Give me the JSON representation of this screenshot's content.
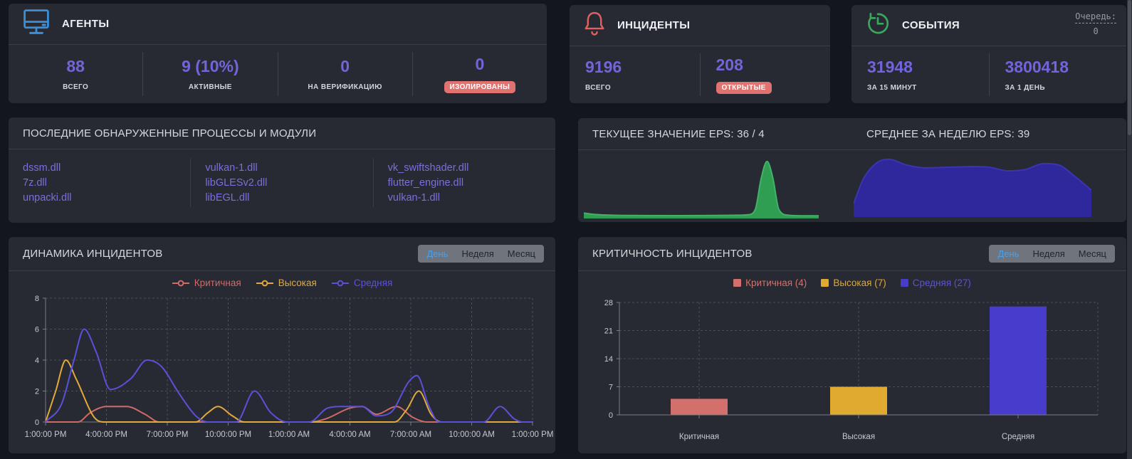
{
  "cards": {
    "agents": {
      "title": "АГЕНТЫ",
      "stats": [
        {
          "value": "88",
          "label": "ВСЕГО"
        },
        {
          "value": "9 (10%)",
          "label": "АКТИВНЫЕ"
        },
        {
          "value": "0",
          "label": "НА ВЕРИФИКАЦИЮ"
        },
        {
          "value": "0",
          "label": "ИЗОЛИРОВАНЫ"
        }
      ]
    },
    "incidents": {
      "title": "ИНЦИДЕНТЫ",
      "stats": [
        {
          "value": "9196",
          "label": "ВСЕГО"
        },
        {
          "value": "208",
          "label": "ОТКРЫТЫЕ"
        }
      ]
    },
    "events": {
      "title": "СОБЫТИЯ",
      "queue": {
        "label": "Очередь:",
        "value": "0"
      },
      "stats": [
        {
          "value": "31948",
          "label": "ЗА 15 МИНУТ"
        },
        {
          "value": "3800418",
          "label": "ЗА 1 ДЕНЬ"
        }
      ]
    },
    "processes": {
      "title": "ПОСЛЕДНИЕ ОБНАРУЖЕННЫЕ ПРОЦЕССЫ И МОДУЛИ",
      "columns": [
        [
          "dssm.dll",
          "7z.dll",
          "unpacki.dll"
        ],
        [
          "vulkan-1.dll",
          "libGLESv2.dll",
          "libEGL.dll"
        ],
        [
          "vk_swiftshader.dll",
          "flutter_engine.dll",
          "vulkan-1.dll"
        ]
      ]
    },
    "dynamics": {
      "title": "ДИНАМИКА ИНЦИДЕНТОВ",
      "tabs": [
        {
          "label": "День",
          "active": true
        },
        {
          "label": "Неделя",
          "active": false
        },
        {
          "label": "Месяц",
          "active": false
        }
      ]
    },
    "criticality": {
      "title": "КРИТИЧНОСТЬ ИНЦИДЕНТОВ",
      "tabs": [
        {
          "label": "День",
          "active": true
        },
        {
          "label": "Неделя",
          "active": false
        },
        {
          "label": "Месяц",
          "active": false
        }
      ]
    }
  },
  "colors": {
    "accent_number": "#7165da",
    "badge_bg": "#e0736f",
    "tab_active": "#4aa0ea",
    "link": "#7a6fdb",
    "agents_icon": "#3a8fd9",
    "incidents_icon": "#e0615f",
    "events_icon": "#3aa85c"
  },
  "chart_data": [
    {
      "id": "eps_current",
      "type": "area",
      "title": "ТЕКУЩЕЕ ЗНАЧЕНИЕ EPS: 36 / 4",
      "color": "#2f9e53",
      "stroke": "#43b269",
      "ymax": 40,
      "x": [
        0,
        0.04,
        0.12,
        0.25,
        0.4,
        0.5,
        0.6,
        0.66,
        0.7,
        0.73,
        0.755,
        0.78,
        0.805,
        0.83,
        0.87,
        0.93,
        1
      ],
      "values": [
        2.6,
        1.8,
        1.2,
        1.0,
        0.9,
        1.0,
        1.1,
        1.2,
        1.5,
        5,
        25,
        36,
        25,
        5,
        1.2,
        0.8,
        0.8
      ]
    },
    {
      "id": "eps_week",
      "type": "area",
      "title": "СРЕДНЕЕ ЗА НЕДЕЛЮ EPS: 39",
      "color": "#2e289c",
      "stroke": "#3c34b0",
      "ymax": 100,
      "x": [
        0,
        0.04,
        0.1,
        0.15,
        0.22,
        0.3,
        0.4,
        0.5,
        0.57,
        0.65,
        0.72,
        0.8,
        0.86,
        0.93,
        1
      ],
      "values": [
        20,
        60,
        88,
        93,
        84,
        79,
        80,
        81,
        80,
        74,
        76,
        86,
        84,
        65,
        42
      ]
    },
    {
      "id": "incident_dynamics",
      "type": "line",
      "title": "ДИНАМИКА ИНЦИДЕНТОВ",
      "x_labels": [
        "1:00:00 PM",
        "4:00:00 PM",
        "7:00:00 PM",
        "10:00:00 PM",
        "1:00:00 AM",
        "4:00:00 AM",
        "7:00:00 AM",
        "10:00:00 AM",
        "1:00:00 PM"
      ],
      "x_range": [
        0,
        24
      ],
      "ylim": [
        0,
        8
      ],
      "yticks": [
        0,
        2,
        4,
        6,
        8
      ],
      "grid": true,
      "legend_position": "top",
      "series": [
        {
          "name": "Критичная",
          "color": "#d06a66",
          "points": [
            [
              0,
              0
            ],
            [
              1.6,
              0
            ],
            [
              2.2,
              0.6
            ],
            [
              3,
              1
            ],
            [
              4,
              1
            ],
            [
              4.9,
              0.5
            ],
            [
              5.6,
              0
            ],
            [
              7,
              0
            ],
            [
              9,
              0
            ],
            [
              11,
              0
            ],
            [
              13,
              0
            ],
            [
              13.8,
              0.2
            ],
            [
              15,
              0.9
            ],
            [
              15.6,
              1
            ],
            [
              16.3,
              0.5
            ],
            [
              17.3,
              1
            ],
            [
              18.1,
              0.3
            ],
            [
              18.8,
              0
            ],
            [
              20,
              0
            ],
            [
              22,
              0
            ],
            [
              24,
              0
            ]
          ]
        },
        {
          "name": "Высокая",
          "color": "#e2a93b",
          "points": [
            [
              0,
              0
            ],
            [
              0.5,
              2
            ],
            [
              1,
              4
            ],
            [
              1.5,
              2.8
            ],
            [
              2.4,
              0.3
            ],
            [
              2.9,
              0
            ],
            [
              5,
              0
            ],
            [
              7.4,
              0
            ],
            [
              8,
              0.6
            ],
            [
              8.5,
              1
            ],
            [
              9.2,
              0.4
            ],
            [
              9.8,
              0
            ],
            [
              12,
              0
            ],
            [
              14,
              0
            ],
            [
              16,
              0
            ],
            [
              17.2,
              0
            ],
            [
              17.8,
              0.8
            ],
            [
              18.4,
              2
            ],
            [
              19,
              0.5
            ],
            [
              19.5,
              0
            ],
            [
              21,
              0
            ],
            [
              23,
              0
            ],
            [
              24,
              0
            ]
          ]
        },
        {
          "name": "Средняя",
          "color": "#5b51d8",
          "points": [
            [
              0,
              0
            ],
            [
              0.8,
              1.2
            ],
            [
              1.4,
              4
            ],
            [
              1.9,
              6
            ],
            [
              2.5,
              4.5
            ],
            [
              3.2,
              2.1
            ],
            [
              4.2,
              2.8
            ],
            [
              5,
              4
            ],
            [
              5.7,
              3.6
            ],
            [
              6.6,
              1.8
            ],
            [
              7.4,
              0.4
            ],
            [
              8,
              0
            ],
            [
              9.4,
              0
            ],
            [
              10.3,
              2
            ],
            [
              11.1,
              0.6
            ],
            [
              11.9,
              0
            ],
            [
              13,
              0
            ],
            [
              13.9,
              0.9
            ],
            [
              14.6,
              1
            ],
            [
              15.6,
              1
            ],
            [
              16.3,
              0.4
            ],
            [
              17,
              0.6
            ],
            [
              17.9,
              2.6
            ],
            [
              18.3,
              3
            ],
            [
              18.9,
              1
            ],
            [
              19.4,
              0
            ],
            [
              20.5,
              0
            ],
            [
              21.6,
              0
            ],
            [
              22.4,
              1
            ],
            [
              23.1,
              0.2
            ],
            [
              23.5,
              0
            ],
            [
              24,
              0
            ]
          ]
        }
      ]
    },
    {
      "id": "incident_criticality",
      "type": "bar",
      "title": "КРИТИЧНОСТЬ ИНЦИДЕНТОВ",
      "categories": [
        "Критичная",
        "Высокая",
        "Средняя"
      ],
      "values": [
        4,
        7,
        27
      ],
      "colors": [
        "#d4706b",
        "#e0a930",
        "#483ccd"
      ],
      "legend": [
        "Критичная (4)",
        "Высокая (7)",
        "Средняя (27)"
      ],
      "ylim": [
        0,
        28
      ],
      "yticks": [
        0,
        7,
        14,
        21,
        28
      ],
      "grid": true,
      "legend_position": "top"
    }
  ]
}
